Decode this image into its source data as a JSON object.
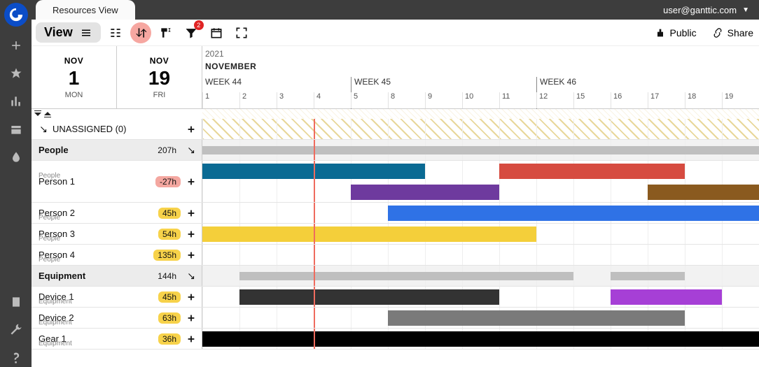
{
  "header": {
    "tab_title": "Resources View",
    "user": "user@ganttic.com"
  },
  "toolbar": {
    "view_label": "View",
    "filter_badge": "2",
    "public_label": "Public",
    "share_label": "Share"
  },
  "date_range": {
    "start": {
      "month": "NOV",
      "day": "1",
      "dow": "MON"
    },
    "end": {
      "month": "NOV",
      "day": "19",
      "dow": "FRI"
    },
    "year": "2021",
    "month_label": "NOVEMBER",
    "weeks": [
      {
        "label": "WEEK 44",
        "start_index": 0
      },
      {
        "label": "WEEK 45",
        "start_index": 4
      },
      {
        "label": "WEEK 46",
        "start_index": 9
      }
    ],
    "days": [
      "1",
      "2",
      "3",
      "4",
      "5",
      "8",
      "9",
      "10",
      "11",
      "12",
      "15",
      "16",
      "17",
      "18",
      "19"
    ]
  },
  "unassigned": {
    "label": "UNASSIGNED (0)"
  },
  "groups": [
    {
      "name": "People",
      "hours": "207h",
      "sumbars": [
        {
          "start": 0,
          "end": 5
        },
        {
          "start": 5,
          "end": 9
        },
        {
          "start": 9,
          "end": 12
        },
        {
          "start": 12,
          "end": 15
        }
      ],
      "rows": [
        {
          "name": "Person 1",
          "sub": "People",
          "hours": "-27h",
          "neg": true,
          "double": true,
          "bars": [
            {
              "start": 0,
              "end": 6,
              "color": "#0a6a93",
              "lane": 1
            },
            {
              "start": 8,
              "end": 13,
              "color": "#d64b40",
              "lane": 1
            },
            {
              "start": 4,
              "end": 8,
              "color": "#6e3a9e",
              "lane": 2
            },
            {
              "start": 12,
              "end": 15,
              "color": "#8a5a1f",
              "lane": 2
            }
          ]
        },
        {
          "name": "Person 2",
          "sub": "People",
          "hours": "45h",
          "bars": [
            {
              "start": 5,
              "end": 15,
              "color": "#2f72e6",
              "lane": 1
            }
          ]
        },
        {
          "name": "Person 3",
          "sub": "People",
          "hours": "54h",
          "bars": [
            {
              "start": 0,
              "end": 9,
              "color": "#f4cf3a",
              "lane": 1
            }
          ]
        },
        {
          "name": "Person 4",
          "sub": "People",
          "hours": "135h",
          "bars": []
        }
      ]
    },
    {
      "name": "Equipment",
      "hours": "144h",
      "sumbars": [
        {
          "start": 1,
          "end": 5
        },
        {
          "start": 5,
          "end": 8
        },
        {
          "start": 8,
          "end": 10
        },
        {
          "start": 11,
          "end": 13
        }
      ],
      "rows": [
        {
          "name": "Device 1",
          "sub": "Equipment",
          "hours": "45h",
          "bars": [
            {
              "start": 1,
              "end": 8,
              "color": "#333333",
              "lane": 1
            },
            {
              "start": 11,
              "end": 14,
              "color": "#a63fd6",
              "lane": 1
            }
          ]
        },
        {
          "name": "Device 2",
          "sub": "Equipment",
          "hours": "63h",
          "bars": [
            {
              "start": 5,
              "end": 13,
              "color": "#7a7a7a",
              "lane": 1
            }
          ]
        },
        {
          "name": "Gear 1",
          "sub": "Equipment",
          "hours": "36h",
          "bars": [
            {
              "start": 0,
              "end": 15,
              "color": "#000000",
              "lane": 1
            }
          ]
        }
      ]
    }
  ]
}
